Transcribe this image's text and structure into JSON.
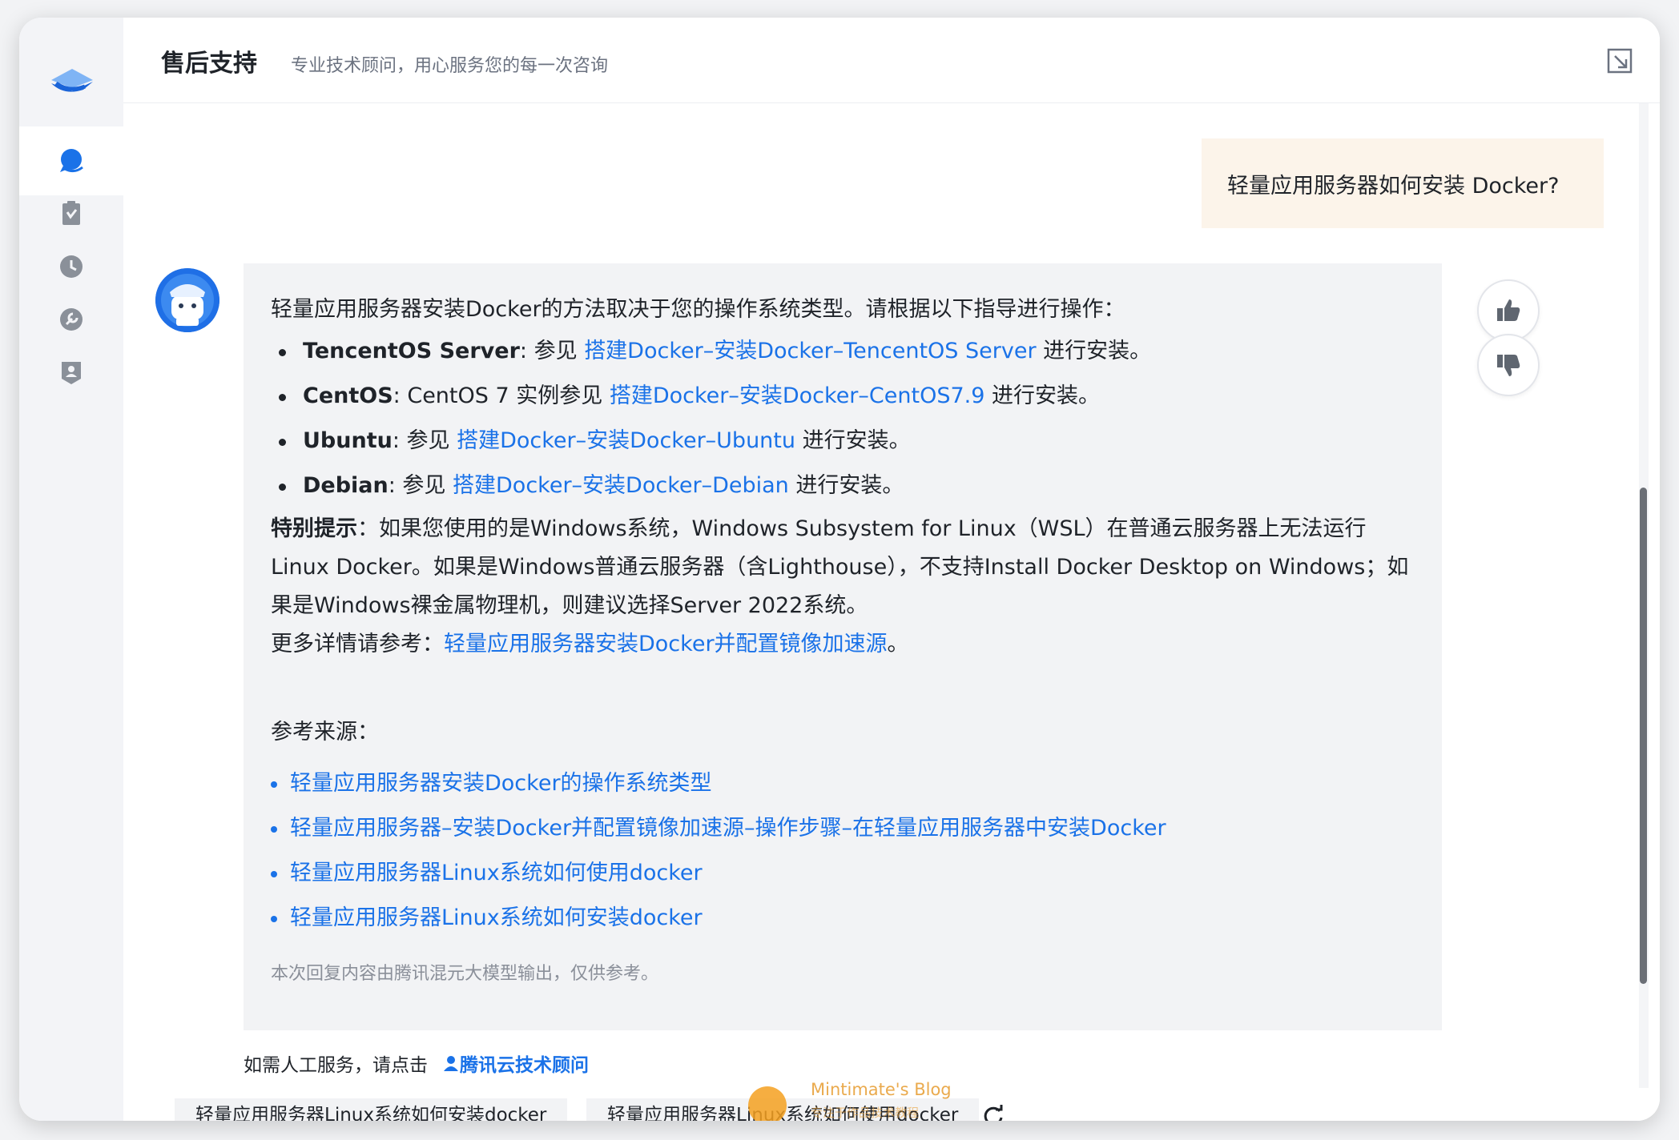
{
  "header": {
    "title": "售后支持",
    "subtitle": "专业技术顾问，用心服务您的每一次咨询"
  },
  "sidebar": {
    "items": [
      {
        "icon": "chat-icon",
        "active": true
      },
      {
        "icon": "ticket-icon",
        "active": false
      },
      {
        "icon": "clock-icon",
        "active": false
      },
      {
        "icon": "wrench-icon",
        "active": false
      },
      {
        "icon": "person-badge-icon",
        "active": false
      }
    ]
  },
  "user_message": "轻量应用服务器如何安装 Docker?",
  "answer": {
    "intro": "轻量应用服务器安装Docker的方法取决于您的操作系统类型。请根据以下指导进行操作：",
    "items": [
      {
        "os": "TencentOS Server",
        "pre": ": 参见 ",
        "link": "搭建Docker–安装Docker–TencentOS Server",
        "post": " 进行安装。"
      },
      {
        "os": "CentOS",
        "pre": ": CentOS 7 实例参见 ",
        "link": "搭建Docker–安装Docker–CentOS7.9",
        "post": " 进行安装。"
      },
      {
        "os": "Ubuntu",
        "pre": ": 参见 ",
        "link": "搭建Docker–安装Docker–Ubuntu",
        "post": " 进行安装。"
      },
      {
        "os": "Debian",
        "pre": ": 参见 ",
        "link": "搭建Docker–安装Docker–Debian",
        "post": " 进行安装。"
      }
    ],
    "tip_label": "特别提示",
    "tip_line1": "：如果您使用的是Windows系统，Windows Subsystem for Linux（WSL）在普通云服务器上无法运行",
    "tip_line2": "Linux Docker。如果是Windows普通云服务器（含Lighthouse），不支持Install Docker Desktop on Windows；如",
    "tip_line3": "果是Windows裸金属物理机，则建议选择Server 2022系统。",
    "more_label": "更多详情请参考：",
    "more_link": "轻量应用服务器安装Docker并配置镜像加速源",
    "more_end": "。",
    "refs_title": "参考来源：",
    "refs": [
      "轻量应用服务器安装Docker的操作系统类型",
      "轻量应用服务器–安装Docker并配置镜像加速源–操作步骤–在轻量应用服务器中安装Docker",
      "轻量应用服务器Linux系统如何使用docker",
      "轻量应用服务器Linux系统如何安装docker"
    ],
    "disclaimer": "本次回复内容由腾讯混元大模型输出，仅供参考。"
  },
  "human_service": {
    "prompt": "如需人工服务，请点击",
    "advisor": "腾讯云技术顾问"
  },
  "suggestions": [
    "轻量应用服务器Linux系统如何安装docker",
    "轻量应用服务器Linux系统如何使用docker"
  ],
  "watermark": {
    "name": "Mintimate's Blog",
    "sub": "专注于作品技术教程"
  },
  "colors": {
    "accent": "#1a72e8",
    "user_bubble": "#fcf4ea",
    "answer_bg": "#f2f3f5"
  }
}
